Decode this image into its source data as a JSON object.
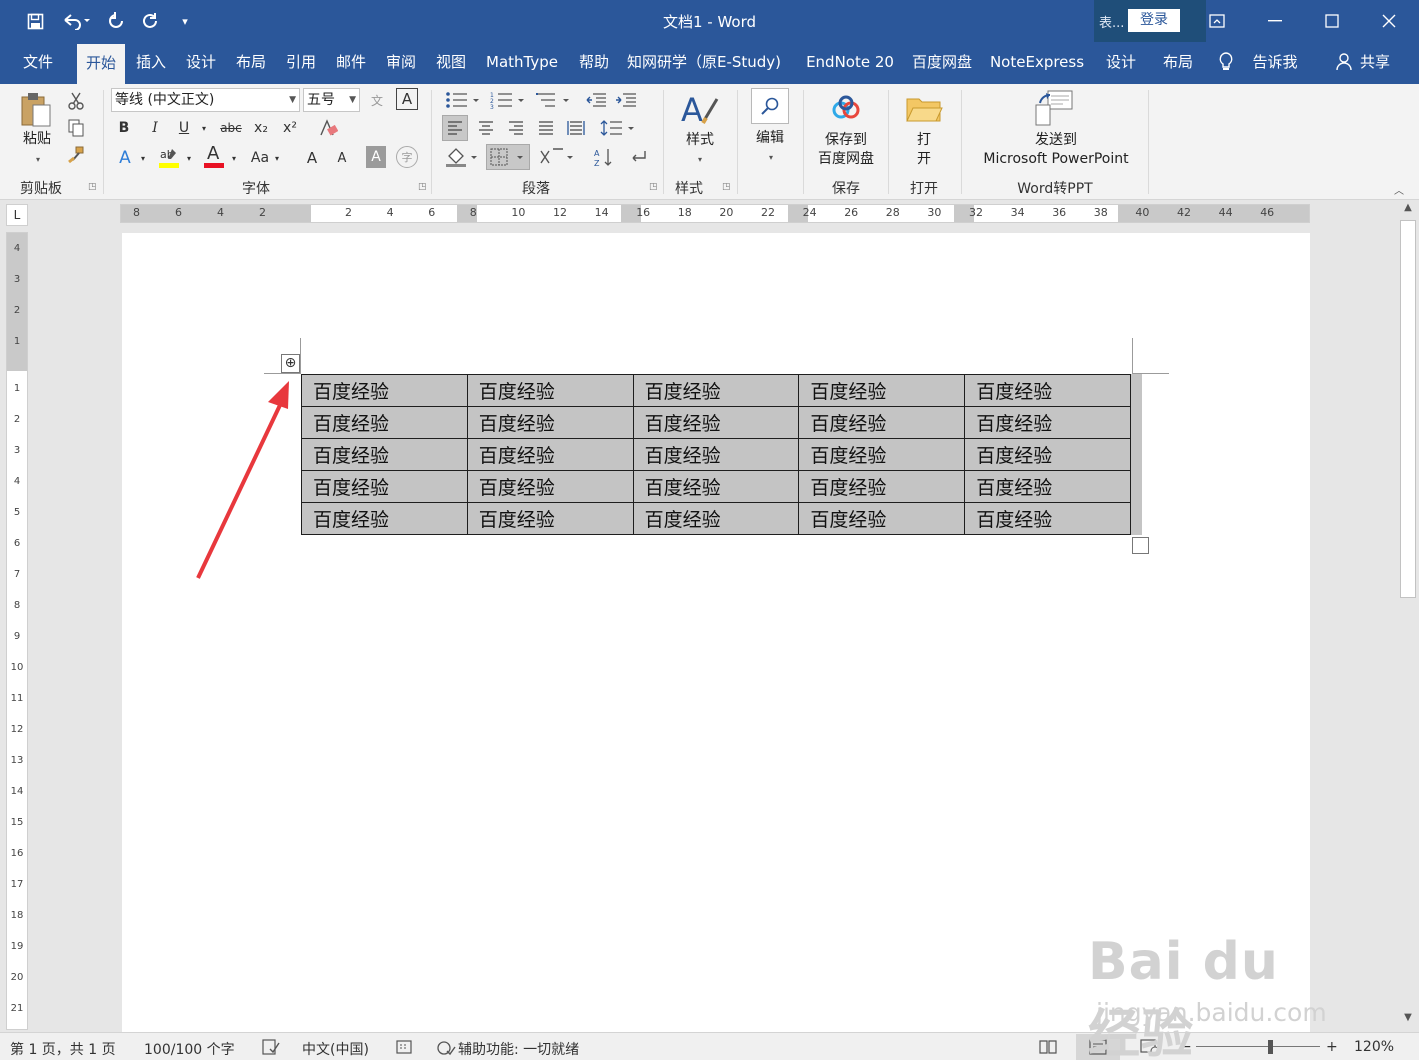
{
  "window": {
    "title": "文档1 - Word",
    "context_label": "表...",
    "login": "登录",
    "icons": [
      "save-icon",
      "undo-icon",
      "redo-icon",
      "refresh-icon",
      "customize-qat-icon",
      "ribbon-display-icon",
      "minimize-icon",
      "maximize-icon",
      "close-icon"
    ]
  },
  "tabs": [
    {
      "label": "文件"
    },
    {
      "label": "开始",
      "active": true
    },
    {
      "label": "插入"
    },
    {
      "label": "设计"
    },
    {
      "label": "布局"
    },
    {
      "label": "引用"
    },
    {
      "label": "邮件"
    },
    {
      "label": "审阅"
    },
    {
      "label": "视图"
    },
    {
      "label": "MathType"
    },
    {
      "label": "帮助"
    },
    {
      "label": "知网研学（原E-Study)"
    },
    {
      "label": "EndNote 20"
    },
    {
      "label": "百度网盘"
    },
    {
      "label": "NoteExpress"
    },
    {
      "label": "设计"
    },
    {
      "label": "布局"
    }
  ],
  "tell_me": "告诉我",
  "share": "共享",
  "ribbon": {
    "clipboard": {
      "paste": "粘贴",
      "label": "剪贴板"
    },
    "font": {
      "name": "等线 (中文正文)",
      "size": "五号",
      "label": "字体",
      "bold": "B",
      "italic": "I",
      "underline": "U",
      "strike": "abc",
      "subscript": "x₂",
      "superscript": "x²",
      "case": "Aa",
      "grow": "A",
      "shrink": "A",
      "font_color": "A",
      "text_effect": "A",
      "highlight_color": "#ffff00",
      "font_color_bar": "#e81123"
    },
    "paragraph": {
      "label": "段落"
    },
    "styles": {
      "button": "样式",
      "label": "样式"
    },
    "editing": {
      "button": "编辑"
    },
    "save": {
      "button_line1": "保存到",
      "button_line2": "百度网盘",
      "label": "保存"
    },
    "open": {
      "button_line1": "打",
      "button_line2": "开",
      "label": "打开"
    },
    "word2ppt": {
      "button_line1": "发送到",
      "button_line2": "Microsoft PowerPoint",
      "label": "Word转PPT"
    }
  },
  "ruler": {
    "corner": "L",
    "h_left": [
      "8",
      "6",
      "4",
      "2"
    ],
    "h_right": [
      "2",
      "4",
      "6",
      "8",
      "10",
      "12",
      "14",
      "16",
      "18",
      "20",
      "22",
      "24",
      "26",
      "28",
      "30",
      "32",
      "34",
      "36",
      "38",
      "40",
      "42",
      "44",
      "46"
    ],
    "v_top": [
      "4",
      "3",
      "2",
      "1"
    ],
    "v_body": [
      "1",
      "2",
      "3",
      "4",
      "5",
      "6",
      "7",
      "8",
      "9",
      "10",
      "11",
      "12",
      "13",
      "14",
      "15",
      "16",
      "17",
      "18",
      "19",
      "20",
      "21"
    ]
  },
  "table": {
    "rows": [
      [
        "百度经验",
        "百度经验",
        "百度经验",
        "百度经验",
        "百度经验"
      ],
      [
        "百度经验",
        "百度经验",
        "百度经验",
        "百度经验",
        "百度经验"
      ],
      [
        "百度经验",
        "百度经验",
        "百度经验",
        "百度经验",
        "百度经验"
      ],
      [
        "百度经验",
        "百度经验",
        "百度经验",
        "百度经验",
        "百度经验"
      ],
      [
        "百度经验",
        "百度经验",
        "百度经验",
        "百度经验",
        "百度经验"
      ]
    ],
    "selected": true,
    "move_handle": "⊕"
  },
  "statusbar": {
    "page": "第 1 页，共 1 页",
    "words": "100/100 个字",
    "language": "中文(中国)",
    "accessibility": "辅助功能: 一切就绪",
    "zoom_minus": "−",
    "zoom_plus": "+",
    "zoom": "120%",
    "zoom_level": 0.6
  },
  "annotation": {
    "arrow_color": "#e8383d"
  },
  "watermark": {
    "main": "Bai du 经验",
    "sub": "jingyan.baidu.com"
  }
}
